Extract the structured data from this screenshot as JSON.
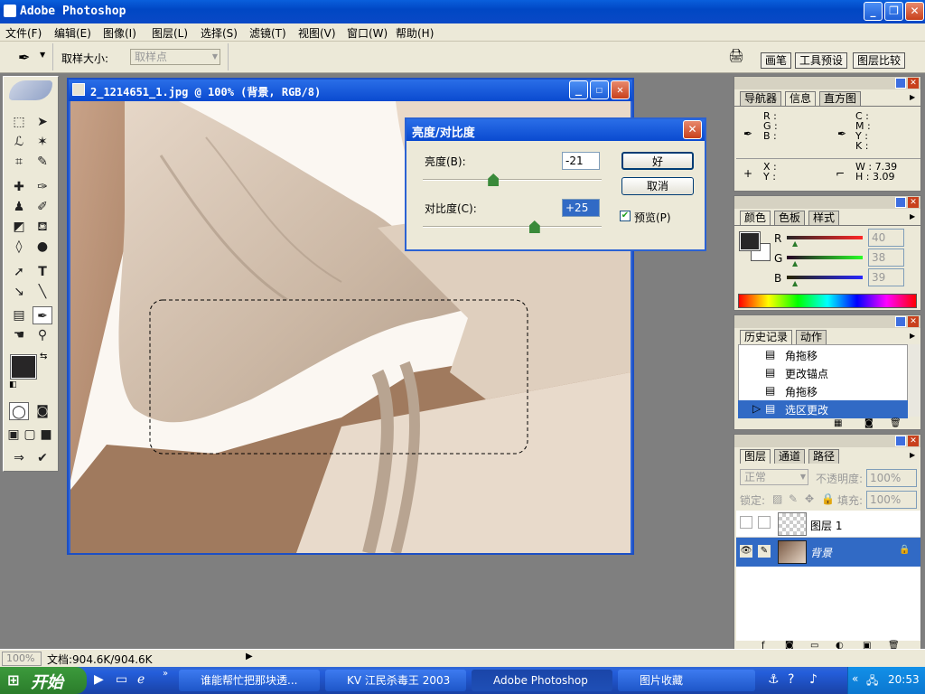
{
  "app": {
    "title": "Adobe Photoshop"
  },
  "menu": [
    "文件(F)",
    "编辑(E)",
    "图像(I)",
    "图层(L)",
    "选择(S)",
    "滤镜(T)",
    "视图(V)",
    "窗口(W)",
    "帮助(H)"
  ],
  "options": {
    "sample_size_label": "取样大小:",
    "sample_size_value": "取样点"
  },
  "palette_well": [
    "画笔",
    "工具预设",
    "图层比较"
  ],
  "document": {
    "title": "2_1214651_1.jpg @ 100% (背景, RGB/8)"
  },
  "dialog": {
    "title": "亮度/对比度",
    "brightness_label": "亮度(B):",
    "brightness_value": "-21",
    "brightness_level_fraction": 0.395,
    "contrast_label": "对比度(C):",
    "contrast_value": "+25",
    "contrast_level_fraction": 0.625,
    "ok_label": "好",
    "cancel_label": "取消",
    "preview_label": "预览(P)",
    "preview_checked": true
  },
  "navigator": {
    "tabs": [
      "导航器",
      "信息",
      "直方图"
    ],
    "active_tab": "信息",
    "rgb_labels": [
      "R :",
      "G :",
      "B :"
    ],
    "cmyk_labels": [
      "C :",
      "M :",
      "Y :",
      "K :"
    ],
    "x_label": "X :",
    "y_label": "Y :",
    "w_label": "W :",
    "w_value": "7.39",
    "h_label": "H :",
    "h_value": "3.09"
  },
  "color_panel": {
    "tabs": [
      "颜色",
      "色板",
      "样式"
    ],
    "r_label": "R",
    "g_label": "G",
    "b_label": "B",
    "r_value": "40",
    "g_value": "38",
    "b_value": "39",
    "foreground": "#282627"
  },
  "history_panel": {
    "tabs": [
      "历史记录",
      "动作"
    ],
    "items": [
      {
        "label": "角拖移"
      },
      {
        "label": "更改锚点"
      },
      {
        "label": "角拖移"
      },
      {
        "label": "选区更改",
        "selected": true
      }
    ]
  },
  "layers_panel": {
    "tabs": [
      "图层",
      "通道",
      "路径"
    ],
    "blend_mode": "正常",
    "opacity_label": "不透明度:",
    "opacity_value": "100%",
    "lock_label": "锁定:",
    "fill_label": "填充:",
    "fill_value": "100%",
    "layers": [
      {
        "name": "图层 1"
      },
      {
        "name": "背景",
        "selected": true
      }
    ]
  },
  "status": {
    "zoom": "100%",
    "doc_info": "文档:904.6K/904.6K"
  },
  "taskbar": {
    "start_label": "开始",
    "tasks": [
      "谁能帮忙把那块透...",
      "KV 江民杀毒王 2003",
      "Adobe Photoshop",
      "图片收藏"
    ],
    "active_task": "Adobe Photoshop",
    "clock": "20:53"
  },
  "colors": {
    "accent": "#316ac5",
    "selection": "#316ac5"
  }
}
